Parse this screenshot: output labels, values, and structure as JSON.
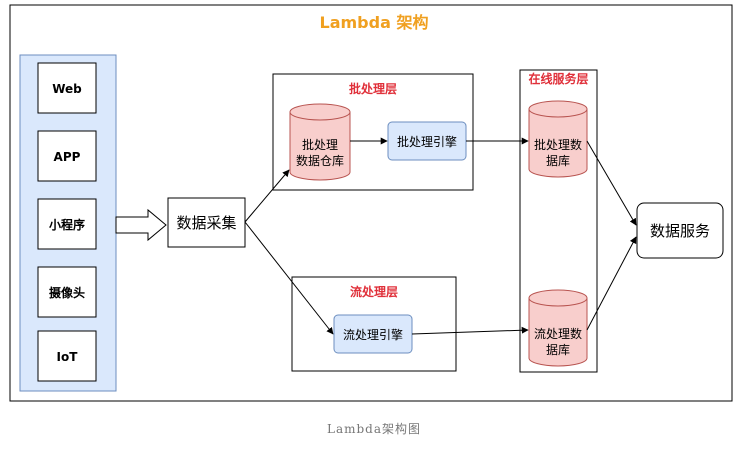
{
  "diagram": {
    "title": "Lambda 架构",
    "sources": [
      "Web",
      "APP",
      "小程序",
      "摄像头",
      "IoT"
    ],
    "collector": "数据采集",
    "batch_layer": {
      "title": "批处理层",
      "warehouse_line1": "批处理",
      "warehouse_line2": "数据仓库",
      "engine": "批处理引擎"
    },
    "stream_layer": {
      "title": "流处理层",
      "engine": "流处理引擎"
    },
    "serving_layer": {
      "title": "在线服务层",
      "batch_db_line1": "批处理数",
      "batch_db_line2": "据库",
      "stream_db_line1": "流处理数",
      "stream_db_line2": "据库"
    },
    "service": "数据服务"
  },
  "caption": "Lambda架构图",
  "colors": {
    "title": "#f0a020",
    "layer_title": "#e0303a",
    "source_panel_fill": "#dae8fc",
    "source_panel_stroke": "#6c8ebf",
    "cylinder_fill": "#f8cecc",
    "cylinder_stroke": "#b85450",
    "engine_fill": "#dae8fc",
    "engine_stroke": "#6c8ebf",
    "line": "#000000"
  }
}
